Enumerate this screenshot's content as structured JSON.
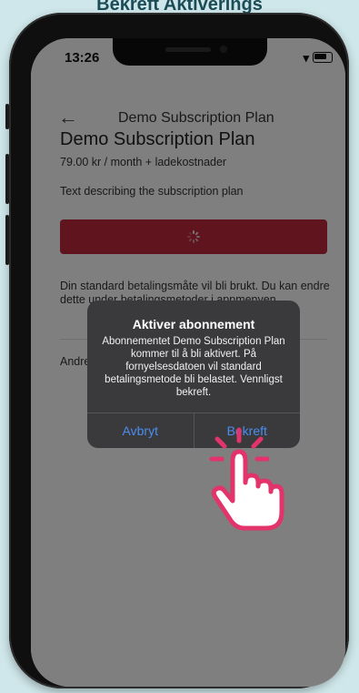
{
  "caption": "Bekreft Aktiverings",
  "status": {
    "time": "13:26"
  },
  "appbar": {
    "title": "Demo Subscription Plan",
    "back_icon": "arrow-left-icon"
  },
  "plan": {
    "title": "Demo Subscription Plan",
    "price": "79.00 kr / month + ladekostnader",
    "description": "Text describing the subscription plan"
  },
  "info": "Din standard betalingsmåte vil bli brukt. Du kan endre dette under betalingsmetoder i appmenyen.",
  "other": "Andre",
  "alert": {
    "title": "Aktiver abonnement",
    "message": "Abonnementet Demo Subscription Plan kommer til å bli aktivert. På fornyelsesdatoen vil standard betalingsmetode bli belastet. Vennligst bekreft.",
    "cancel_label": "Avbryt",
    "confirm_label": "Bekreft"
  },
  "colors": {
    "background": "#cfe7ea",
    "button": "#c0293c",
    "alert_bg": "#3a3a3c",
    "link": "#4a8df0",
    "hand": "#e2336b"
  }
}
